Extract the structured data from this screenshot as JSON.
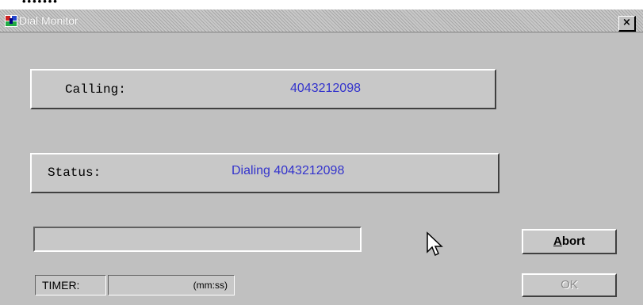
{
  "background_window": {
    "text": "•••••••"
  },
  "window": {
    "title": "Dial Monitor",
    "icon": "phone-modem-icon",
    "close_label": "×"
  },
  "calling": {
    "label": "Calling:",
    "value": "4043212098"
  },
  "status": {
    "label": "Status:",
    "value": "Dialing 4043212098"
  },
  "progress": {
    "value": 0
  },
  "buttons": {
    "abort": {
      "label_accel": "A",
      "label_rest": "bort"
    },
    "ok": {
      "label": "OK",
      "enabled": false
    }
  },
  "timer": {
    "label": "TIMER:",
    "value": "",
    "unit": "(mm:ss)"
  },
  "colors": {
    "value_text": "#3333cc",
    "face": "#c0c0c0"
  }
}
